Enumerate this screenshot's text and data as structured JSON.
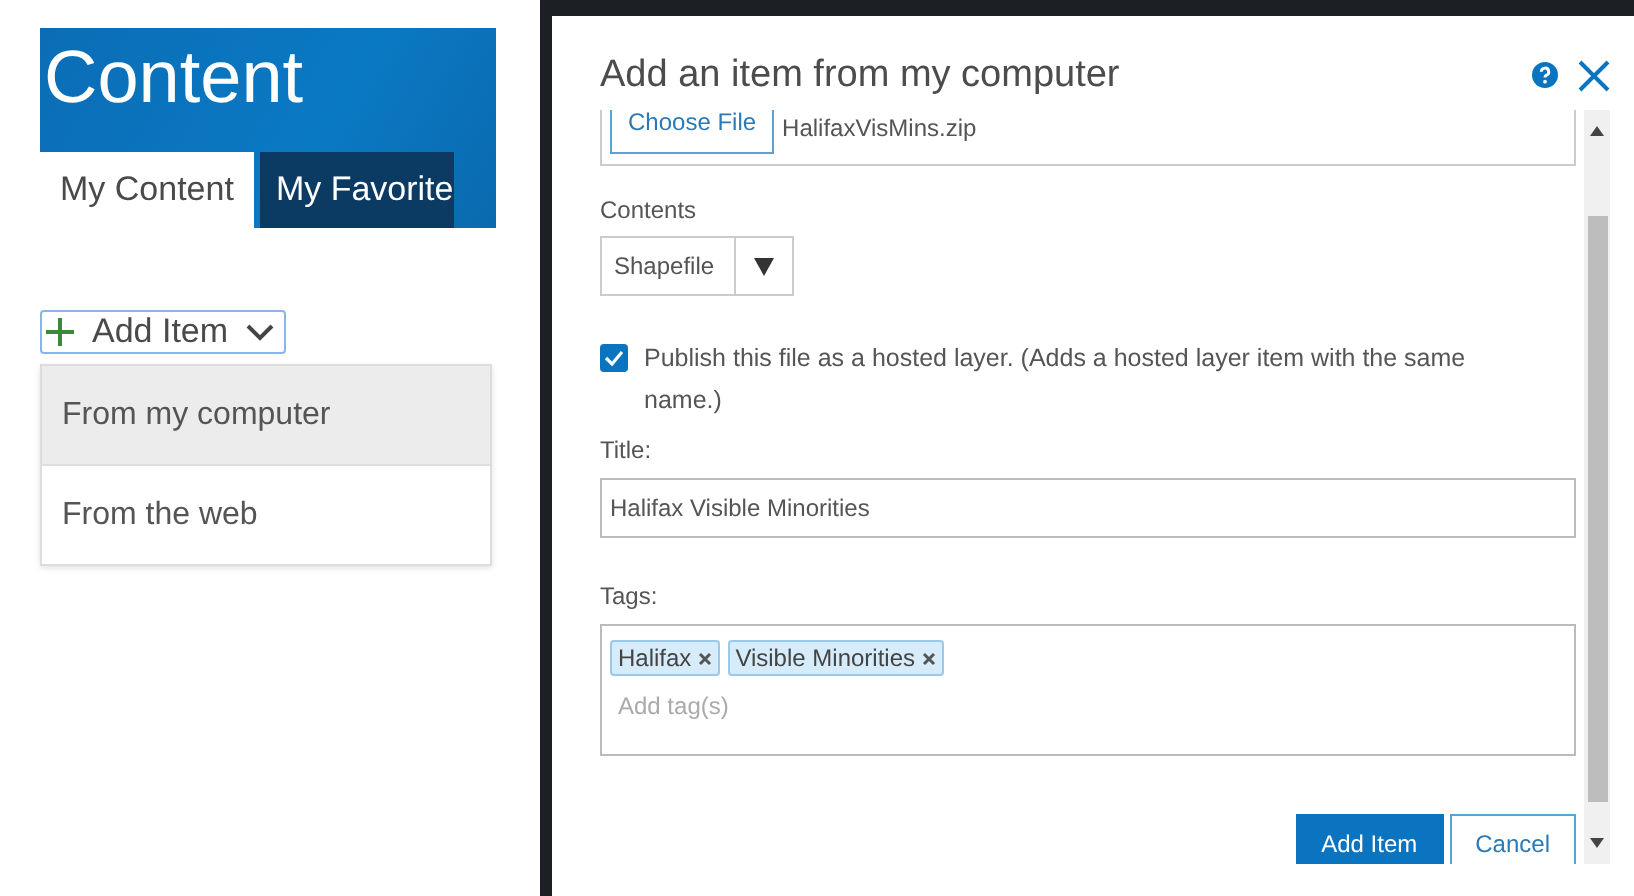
{
  "left_panel": {
    "header_title": "Content",
    "tabs": [
      {
        "label": "My Content",
        "selected": true
      },
      {
        "label": "My Favorite",
        "selected": false
      }
    ],
    "add_button": {
      "label": "Add Item"
    },
    "menu": [
      {
        "label": "From my computer",
        "selected": true
      },
      {
        "label": "From the web",
        "selected": false
      }
    ]
  },
  "dialog": {
    "title": "Add an item from my computer",
    "file": {
      "button": "Choose File",
      "filename": "HalifaxVisMins.zip"
    },
    "contents_label": "Contents",
    "contents_value": "Shapefile",
    "publish": {
      "checked": true,
      "label": "Publish this file as a hosted layer. (Adds a hosted layer item with the same name.)"
    },
    "title_label": "Title:",
    "title_value": "Halifax Visible Minorities",
    "tags_label": "Tags:",
    "tags": [
      "Halifax",
      "Visible Minorities"
    ],
    "tags_placeholder": "Add tag(s)",
    "buttons": [
      {
        "label": "Add Item",
        "kind": "primary"
      },
      {
        "label": "Cancel",
        "kind": "secondary"
      }
    ]
  }
}
